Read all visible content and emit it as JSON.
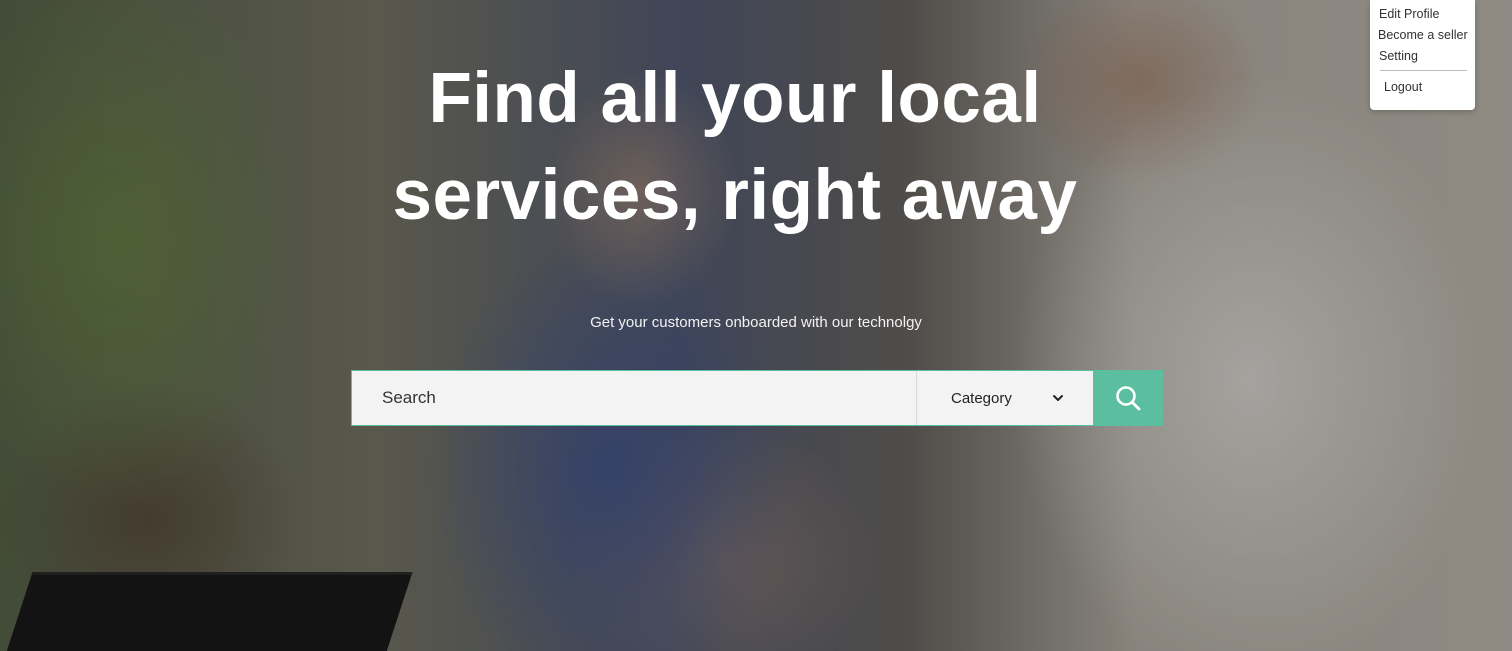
{
  "hero": {
    "title_line1": "Find all your local",
    "title_line2": "services, right away",
    "subtitle": "Get your customers onboarded with our technolgy"
  },
  "search": {
    "placeholder": "Search",
    "category_label": "Category",
    "search_icon": "search-icon",
    "chevron_icon": "chevron-down-icon"
  },
  "user_menu": {
    "items": [
      "Edit Profile",
      "Become a seller",
      "Setting"
    ],
    "logout": "Logout"
  },
  "colors": {
    "accent": "#5bbf9f",
    "menu_bg": "#ffffff",
    "search_bg": "#f3f3f3"
  }
}
